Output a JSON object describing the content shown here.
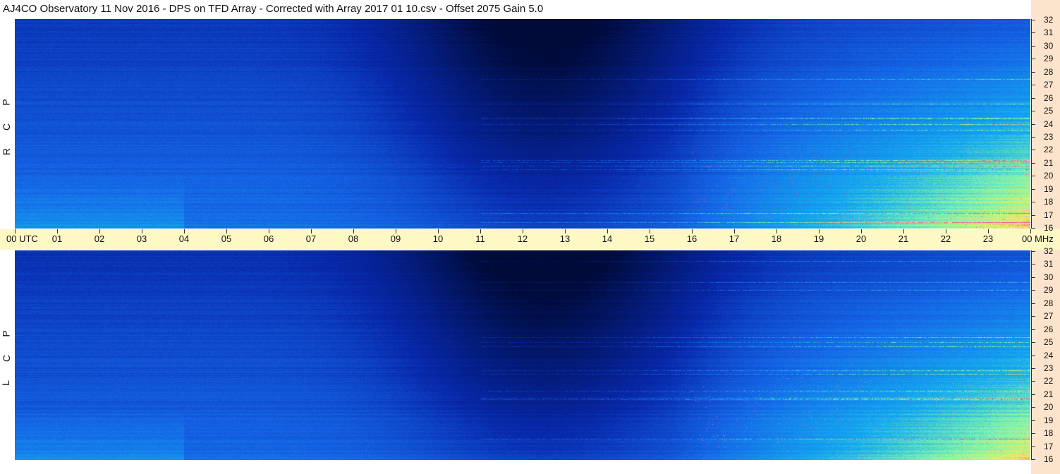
{
  "header": {
    "title": "AJ4CO Observatory  11 Nov 2016  -  DPS on TFD Array  -  Corrected with Array 2017 01 10.csv  -  Offset 2075  Gain 5.0"
  },
  "chart_data": [
    {
      "type": "heatmap",
      "polarization_label": [
        "R",
        "C",
        "P"
      ],
      "x_range": [
        0,
        24
      ],
      "y_range": [
        16,
        32
      ],
      "y_ticks": [
        "16",
        "17",
        "18",
        "19",
        "20",
        "21",
        "22",
        "23",
        "24",
        "25",
        "26",
        "27",
        "28",
        "29",
        "30",
        "31",
        "32"
      ]
    },
    {
      "type": "heatmap",
      "polarization_label": [
        "L",
        "C",
        "P"
      ],
      "x_range": [
        0,
        24
      ],
      "y_range": [
        16,
        32
      ],
      "y_ticks": [
        "16",
        "17",
        "18",
        "19",
        "20",
        "21",
        "22",
        "23",
        "24",
        "25",
        "26",
        "27",
        "28",
        "29",
        "30",
        "31",
        "32"
      ]
    }
  ],
  "utc_axis": {
    "ticks": [
      "00",
      "01",
      "02",
      "03",
      "04",
      "05",
      "06",
      "07",
      "08",
      "09",
      "10",
      "11",
      "12",
      "13",
      "14",
      "15",
      "16",
      "17",
      "18",
      "19",
      "20",
      "21",
      "22",
      "23",
      "00"
    ],
    "first_unit": "UTC",
    "last_unit": "MHz"
  },
  "colors": {
    "background": "#ffffff",
    "utc_axis_bg": "#fdf8c4",
    "right_rail_bg": "#fce4cc",
    "colormap_low": "#000b3a",
    "colormap_mid": "#1565e6",
    "colormap_high": "#7cf3b0",
    "colormap_peak": "#ff3fb0"
  }
}
